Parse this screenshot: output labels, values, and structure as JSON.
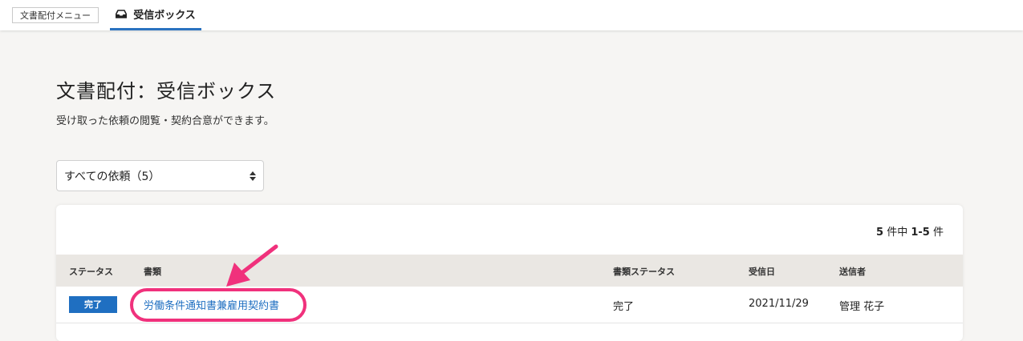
{
  "header": {
    "menu_button_label": "文書配付メニュー",
    "active_tab_label": "受信ボックス",
    "active_tab_icon": "inbox-icon",
    "accent_color": "#2a72c0"
  },
  "page": {
    "title": "文書配付：受信ボックス",
    "description": "受け取った依頼の閲覧・契約合意ができます。"
  },
  "filter": {
    "selected_option": "すべての依頼（5）"
  },
  "pagination": {
    "total": "5",
    "middle_text": " 件中 ",
    "range": "1-5",
    "suffix": " 件"
  },
  "table": {
    "columns": [
      "ステータス",
      "書類",
      "書類ステータス",
      "受信日",
      "送信者"
    ],
    "rows": [
      {
        "status": "完了",
        "document": "労働条件通知書兼雇用契約書",
        "document_status": "完了",
        "received_date": "2021/11/29",
        "sender": "管理 花子"
      }
    ]
  },
  "annotation": {
    "color": "#f0317c"
  }
}
